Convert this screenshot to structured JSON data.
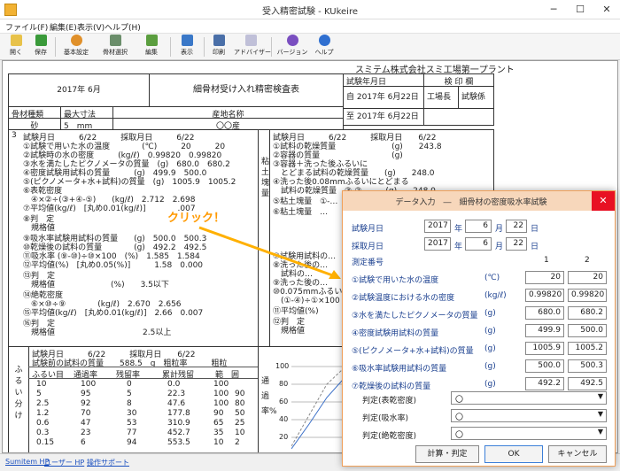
{
  "window": {
    "title": "受入精密試験 - KUkeire",
    "min": "─",
    "max": "☐",
    "close": "✕"
  },
  "menu": [
    "ファイル(F)",
    "編集(E)",
    "表示(V)",
    "ヘルプ(H)"
  ],
  "toolbar": [
    "開く",
    "保存",
    "基本設定",
    "骨材選択",
    "編集",
    "表示",
    "印刷",
    "アドバイザー",
    "バージョン",
    "ヘルプ"
  ],
  "doc": {
    "company": "スミテム株式会社スミ工場第一プラント",
    "date": "2017年 6月",
    "report_title": "細骨材受け入れ精密検査表",
    "test_date_label": "試験年月日",
    "inspection_label": "検 印 欄",
    "from_date": "自 2017年 6月22日",
    "to_date": "至 2017年 6月22日",
    "plant_manager": "工場長",
    "tester": "試験係",
    "h_type": "骨材種類",
    "h_size": "最大寸法",
    "h_origin": "産地名称",
    "v_type": "砂",
    "v_size": "5",
    "v_unit": "mm",
    "v_origin": "〇〇産",
    "num3": "3",
    "left_rows": [
      "試験月日　　　6/22　　　採取月日　　　6/22",
      "①試験で用いた水の温度　　　　(℃)　　　20　　　20",
      "②試験時の水の密度　　　(kg/ℓ)　0.99820　0.99820",
      "③水を満たしたピクノメータの質量　(g)　680.0　680.2",
      "④密度試験用試料の質量　　　(g)　499.9　500.0",
      "⑤(ピクノメータ+水+試料)の質量　(g)　1005.9　1005.2",
      "⑥表乾密度",
      "　④×②÷(③+④-⑤)　　(kg/ℓ)　2.712　2.698",
      "⑦平均値(kg/ℓ)　[丸め0.01(kg/ℓ)]　　　　.007",
      "⑧判　定",
      "　規格値",
      "⑨吸水率試験用試料の質量　　(g)　500.0　500.3",
      "⑩乾燥後の試料の質量　　　　(g)　492.2　492.5",
      "⑪吸水率 (⑨-⑩)÷⑩×100　(%)　1.585　1.584",
      "⑫平均値(%)　[丸め0.05(%)]　　　1.58　0.000",
      "⑬判　定",
      "　規格値　　　　　　　(%)　　3.5以下",
      "⑭絶乾密度",
      "　⑥×⑩÷⑨　　　　(kg/ℓ)　2.670　2.656",
      "⑮平均値(kg/ℓ)　[丸め0.01(kg/ℓ)]　2.66　0.007",
      "⑯判　定",
      "　規格値　　　　　　　　　　　2.5以上"
    ],
    "right_rows": [
      "試験月日　　　6/22　　　採取月日　　6/22",
      "①試料の乾燥質量　　　　　　　(g)　　243.8",
      "②容器の質量　　　　　　　　　(g)",
      "③容器＋洗った後ふるいに",
      "　とどまる試料の乾燥質量　　(g)　　248.0",
      "④洗った後0.08mmふるいにとどまる",
      "　試料の乾燥質量　③-②　　　(g)　　248.0",
      "⑤粘土塊量　①-…",
      "⑥粘土塊量　…",
      "⑦試験用試料の…",
      "⑧洗った後の…",
      "　試料の…",
      "⑨洗った後の…",
      "⑩0.075mmふるい…",
      "　(①-④)÷①×100",
      "⑪平均値(%)",
      "⑫判　定",
      "　規格値"
    ],
    "side_label": "粘土塊量",
    "grading": {
      "date_row": "試験月日　　　6/22　　　採取月日　　6/22",
      "weight_row": "試験前の試料の質量　　588.5　g　粗粒率　　　粗粒",
      "headers": [
        "ふるい目",
        "通過率",
        "残留率",
        "累計残留",
        "範　囲"
      ],
      "rows": [
        [
          "10",
          "100",
          "0",
          "0.0",
          "100"
        ],
        [
          "5",
          "95",
          "5",
          "22.3",
          "100",
          "90"
        ],
        [
          "2.5",
          "92",
          "8",
          "47.6",
          "100",
          "80"
        ],
        [
          "1.2",
          "70",
          "30",
          "177.8",
          "90",
          "50"
        ],
        [
          "0.6",
          "47",
          "53",
          "310.9",
          "65",
          "25"
        ],
        [
          "0.3",
          "23",
          "77",
          "452.7",
          "35",
          "10"
        ],
        [
          "0.15",
          "6",
          "94",
          "553.5",
          "10",
          "2"
        ]
      ],
      "vert_label": "ふるい分け",
      "chart_axis_label": "通過率%",
      "chart_ticks": [
        "100",
        "80",
        "60",
        "40",
        "20"
      ]
    }
  },
  "callout": {
    "text": "クリック！",
    "color": "#ff9900"
  },
  "statusbar": [
    "Sumitem HP",
    "ユーザー HP",
    "操作サポート"
  ],
  "dialog": {
    "title": "データ入力　―　細骨材の密度吸水率試験",
    "test_date_label": "試験月日",
    "sample_date_label": "採取月日",
    "date_year": "2017",
    "date_month": "6",
    "date_day": "22",
    "year_suffix": "年",
    "month_suffix": "月",
    "day_suffix": "日",
    "measure_label": "測定番号",
    "col1": "1",
    "col2": "2",
    "rows": [
      {
        "label": "①試験で用いた水の温度",
        "unit": "(℃)",
        "v1": "20",
        "v2": "20"
      },
      {
        "label": "②試験温度における水の密度",
        "unit": "(kg/ℓ)",
        "v1": "0.99820",
        "v2": "0.99820"
      },
      {
        "label": "③水を満たしたピクノメータの質量",
        "unit": "(g)",
        "v1": "680.0",
        "v2": "680.2"
      },
      {
        "label": "④密度試験用試料の質量",
        "unit": "(g)",
        "v1": "499.9",
        "v2": "500.0"
      },
      {
        "label": "⑤(ピクノメータ+水+試料)の質量",
        "unit": "(g)",
        "v1": "1005.9",
        "v2": "1005.2"
      },
      {
        "label": "⑥吸水率試験用試料の質量",
        "unit": "(g)",
        "v1": "500.0",
        "v2": "500.3"
      },
      {
        "label": "⑦乾燥後の試料の質量",
        "unit": "(g)",
        "v1": "492.2",
        "v2": "492.5"
      }
    ],
    "judge_rows": [
      {
        "label": "判定(表乾密度)",
        "value": "〇"
      },
      {
        "label": "判定(吸水率)",
        "value": "〇"
      },
      {
        "label": "判定(絶乾密度)",
        "value": "〇"
      }
    ],
    "btn_calc": "計算・判定",
    "btn_ok": "OK",
    "btn_cancel": "キャンセル",
    "close": "✕"
  }
}
